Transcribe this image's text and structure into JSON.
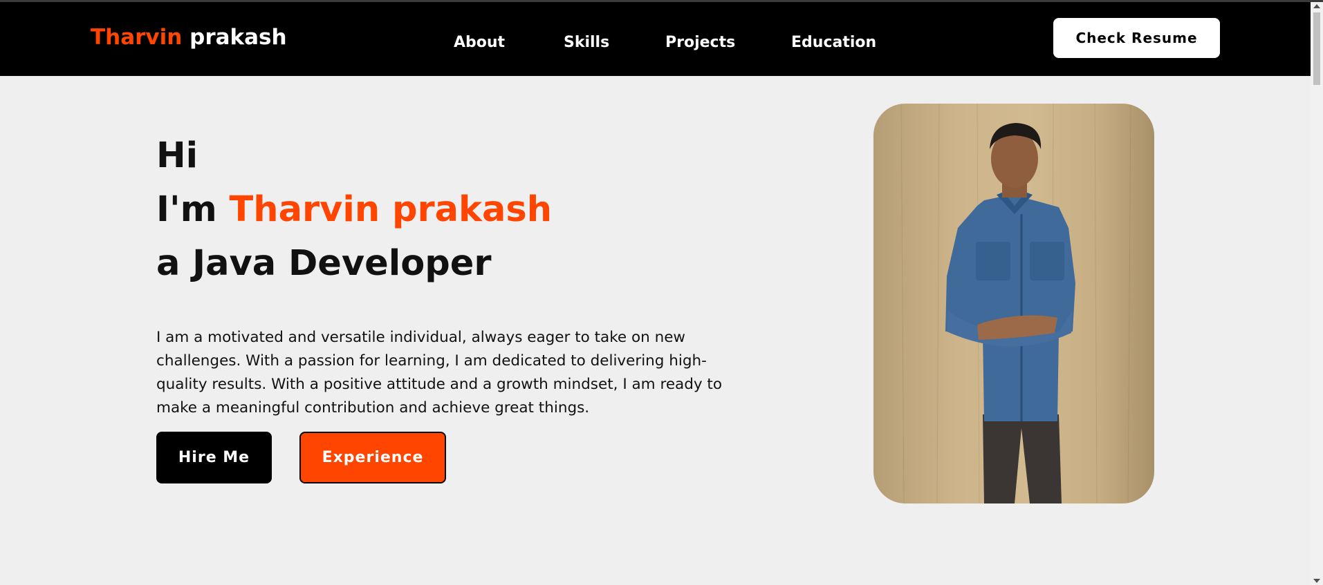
{
  "nav": {
    "logo_first": "Tharvin",
    "logo_last": "prakash",
    "links": [
      "About",
      "Skills",
      "Projects",
      "Education"
    ],
    "resume_button": "Check Resume"
  },
  "hero": {
    "line1": "Hi",
    "line2_prefix": "I'm",
    "line2_name": "Tharvin prakash",
    "line3": "a Java Developer",
    "intro": "I am a motivated and versatile individual, always eager to take on new challenges. With a passion for learning, I am dedicated to delivering high-quality results. With a positive attitude and a growth mindset, I am ready to make a meaningful contribution and achieve great things.",
    "intro_lines": [
      "I am a motivated and versatile individual, always eager to take on new",
      "challenges. With a passion for learning, I am dedicated to delivering high-",
      "quality results. With a positive attitude and a growth mindset, I am ready to",
      "make a meaningful contribution and achieve great things."
    ],
    "hire_button": "Hire Me",
    "experience_button": "Experience"
  },
  "colors": {
    "accent": "#ff4500",
    "navbar": "#000000",
    "background": "#f0efef"
  }
}
